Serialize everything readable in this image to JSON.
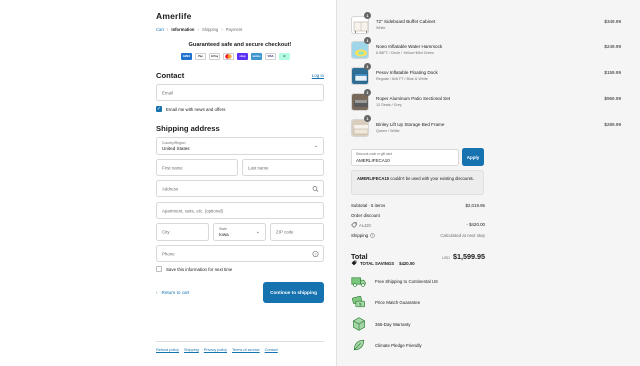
{
  "brand": "Amerlife",
  "breadcrumb": {
    "cart": "Cart",
    "information": "Information",
    "shipping": "Shipping",
    "payment": "Payment"
  },
  "express": {
    "heading": "Guaranteed safe and secure checkout!",
    "methods": [
      "AMEX",
      "Pay",
      "G Pay",
      "MC",
      "shop",
      "venmo",
      "VISA",
      "↺"
    ]
  },
  "contact": {
    "title": "Contact",
    "login_label": "Log in",
    "email_placeholder": "Email",
    "news_label": "Email me with news and offers"
  },
  "shipping": {
    "title": "Shipping address",
    "country_label": "Country/Region",
    "country_value": "United States",
    "first_name_placeholder": "First name",
    "last_name_placeholder": "Last name",
    "address_placeholder": "Address",
    "apartment_placeholder": "Apartment, suite, etc. (optional)",
    "city_placeholder": "City",
    "state_label": "State",
    "state_value": "Iowa",
    "zip_placeholder": "ZIP code",
    "phone_placeholder": "Phone",
    "save_label": "Save this information for next time"
  },
  "nav": {
    "return_label": "Return to cart",
    "continue_label": "Continue to shipping"
  },
  "policies": [
    "Refund policy",
    "Shipping",
    "Privacy policy",
    "Terms of service",
    "Contact"
  ],
  "items": [
    {
      "qty": "1",
      "name": "72\" Sideboard Buffet Cabinet",
      "variant": "White",
      "price": "$349.99"
    },
    {
      "qty": "1",
      "name": "Noeo Inflatable Water Hammock",
      "variant": "6.56FT / Circle / Yellow+Mint Green",
      "price": "$249.99"
    },
    {
      "qty": "1",
      "name": "Pexxv Inflatable Floating Dock",
      "variant": "Regular / 6x6 FT / Blue & White",
      "price": "$159.99"
    },
    {
      "qty": "1",
      "name": "Roper Aluminum Patio Sectional Set",
      "variant": "13 Seats / Grey",
      "price": "$969.99"
    },
    {
      "qty": "1",
      "name": "Binley Lift Up Storage Bed Frame",
      "variant": "Queen / White",
      "price": "$289.99"
    }
  ],
  "discount": {
    "label": "Discount code or gift card",
    "value": "AMERLIFECA10",
    "apply_label": "Apply",
    "warning_code": "AMERLIFECA10",
    "warning_text": " couldn't be used with your existing discounts."
  },
  "summary": {
    "subtotal_label": "Subtotal · 5 items",
    "subtotal_value": "$2,019.95",
    "order_discount_label": "Order discount",
    "discount_code": "AL420",
    "discount_value": "- $420.00",
    "shipping_label": "Shipping",
    "shipping_value": "Calculated at next step",
    "total_label": "Total",
    "currency": "USD",
    "total_value": "$1,599.95",
    "savings_label": "TOTAL SAVINGS",
    "savings_value": "$420.00"
  },
  "perks": [
    "Free Shipping to Continental US",
    "Price Match Guarantee",
    "365-Day Warranty",
    "Climate Pledge Friendly"
  ],
  "colors": {
    "accent": "#1773b0",
    "sidebar_bg": "#f5f5f5",
    "perk_icon": "#2e7d32"
  }
}
